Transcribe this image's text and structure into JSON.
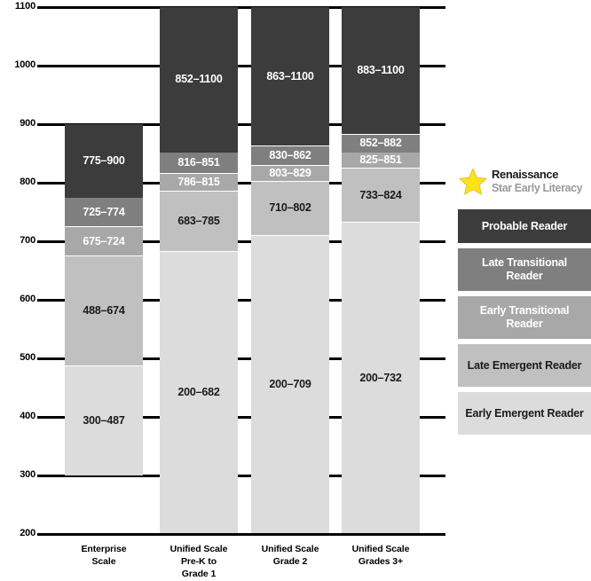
{
  "chart_data": {
    "type": "bar",
    "subtype": "stacked-range",
    "title": "",
    "xlabel": "",
    "ylabel": "",
    "ylim": [
      200,
      1100
    ],
    "yticks": [
      200,
      300,
      400,
      500,
      600,
      700,
      800,
      900,
      1000,
      1100
    ],
    "ytick_labels": [
      "200",
      "300",
      "400",
      "500",
      "600",
      "700",
      "800",
      "900",
      "1000",
      "1100"
    ],
    "grid": true,
    "legend_position": "right",
    "categories": [
      "Enterprise\nScale",
      "Unified Scale\nPre-K to\nGrade 1",
      "Unified Scale\nGrade 2",
      "Unified Scale\nGrades 3+"
    ],
    "series": [
      {
        "name": "Early Emergent Reader",
        "color": "#dcdcdc",
        "label_color": "dark",
        "ranges": [
          {
            "low": 300,
            "high": 487,
            "label": "300–487"
          },
          {
            "low": 200,
            "high": 682,
            "label": "200–682"
          },
          {
            "low": 200,
            "high": 709,
            "label": "200–709"
          },
          {
            "low": 200,
            "high": 732,
            "label": "200–732"
          }
        ]
      },
      {
        "name": "Late Emergent Reader",
        "color": "#c0c0c0",
        "label_color": "dark",
        "ranges": [
          {
            "low": 488,
            "high": 674,
            "label": "488–674"
          },
          {
            "low": 683,
            "high": 785,
            "label": "683–785"
          },
          {
            "low": 710,
            "high": 802,
            "label": "710–802"
          },
          {
            "low": 733,
            "high": 824,
            "label": "733–824"
          }
        ]
      },
      {
        "name": "Early Transitional Reader",
        "color": "#a8a8a8",
        "label_color": "light",
        "ranges": [
          {
            "low": 675,
            "high": 724,
            "label": "675–724"
          },
          {
            "low": 786,
            "high": 815,
            "label": "786–815"
          },
          {
            "low": 803,
            "high": 829,
            "label": "803–829"
          },
          {
            "low": 825,
            "high": 851,
            "label": "825–851"
          }
        ]
      },
      {
        "name": "Late Transitional Reader",
        "color": "#7f7f7f",
        "label_color": "light",
        "ranges": [
          {
            "low": 725,
            "high": 774,
            "label": "725–774"
          },
          {
            "low": 816,
            "high": 851,
            "label": "816–851"
          },
          {
            "low": 830,
            "high": 862,
            "label": "830–862"
          },
          {
            "low": 852,
            "high": 882,
            "label": "852–882"
          }
        ]
      },
      {
        "name": "Probable Reader",
        "color": "#3c3c3c",
        "label_color": "light",
        "ranges": [
          {
            "low": 775,
            "high": 900,
            "label": "775–900"
          },
          {
            "low": 852,
            "high": 1100,
            "label": "852–1100"
          },
          {
            "low": 863,
            "high": 1100,
            "label": "863–1100"
          },
          {
            "low": 883,
            "high": 1100,
            "label": "883–1100"
          }
        ]
      }
    ]
  },
  "xaxis": {
    "categories": [
      {
        "lines": [
          "Enterprise",
          "Scale"
        ]
      },
      {
        "lines": [
          "Unified Scale",
          "Pre-K to",
          "Grade 1"
        ]
      },
      {
        "lines": [
          "Unified Scale",
          "Grade 2"
        ]
      },
      {
        "lines": [
          "Unified Scale",
          "Grades 3+"
        ]
      }
    ]
  },
  "legend": {
    "brand": {
      "name": "Renaissance",
      "subtitle": "Star Early Literacy",
      "star_color": "#ffe11a",
      "star_outline": "#b3a300"
    },
    "items": [
      {
        "label": "Probable Reader",
        "color": "#3c3c3c",
        "text_color": "#ffffff"
      },
      {
        "label": "Late Transitional Reader",
        "color": "#7f7f7f",
        "text_color": "#ffffff"
      },
      {
        "label": "Early Transitional Reader",
        "color": "#a8a8a8",
        "text_color": "#ffffff"
      },
      {
        "label": "Late Emergent Reader",
        "color": "#c0c0c0",
        "text_color": "#1a1a1a"
      },
      {
        "label": "Early Emergent Reader",
        "color": "#dcdcdc",
        "text_color": "#1a1a1a"
      }
    ]
  },
  "colors": {
    "axis": "#000000",
    "background": "#ffffff",
    "probable_reader": "#3c3c3c",
    "late_transitional": "#7f7f7f",
    "early_transitional": "#a8a8a8",
    "late_emergent": "#c0c0c0",
    "early_emergent": "#dcdcdc"
  }
}
